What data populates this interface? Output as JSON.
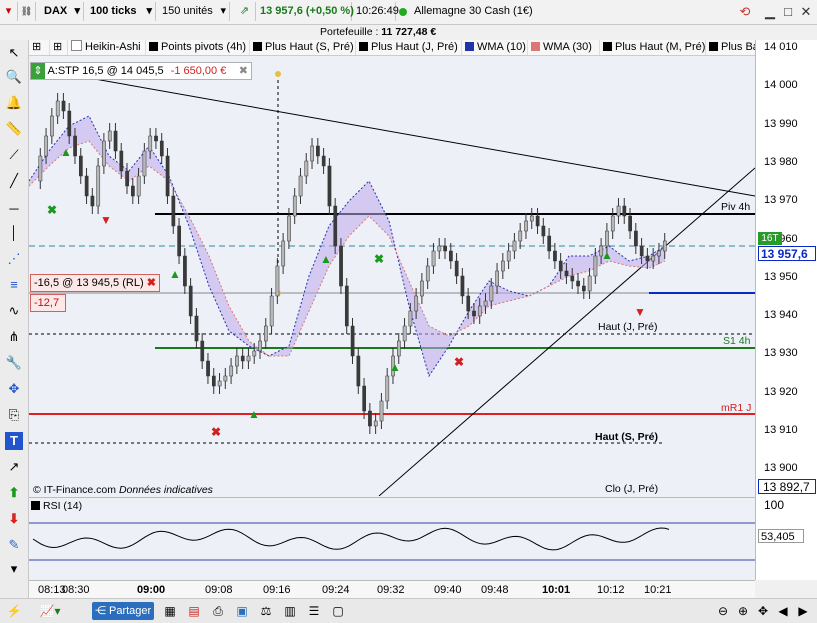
{
  "toolbar": {
    "instrument": "DAX",
    "timeframe": "100 ticks",
    "quantity": "150 unités",
    "price_change": "13 957,6 (+0,50 %)",
    "time": "10:26:49",
    "market_name": "Allemagne 30 Cash (1€)"
  },
  "portfolio": {
    "label": "Portefeuille :",
    "value": "11 727,48 €"
  },
  "indicators": [
    {
      "label": "Heikin-Ashi",
      "color": "#ffffff"
    },
    {
      "label": "Points pivots (4h)",
      "color": "#000000"
    },
    {
      "label": "Plus Haut (S, Pré)",
      "color": "#000000"
    },
    {
      "label": "Plus Haut (J, Pré)",
      "color": "#000000"
    },
    {
      "label": "WMA (10)",
      "color": "#2233aa"
    },
    {
      "label": "WMA (30)",
      "color": "#dd7777"
    },
    {
      "label": "Plus Haut (M, Pré)",
      "color": "#000000"
    },
    {
      "label": "Plus Bas",
      "color": "#000000"
    }
  ],
  "orders": {
    "stop_label": "A:STP",
    "stop_value": "16,5 @ 14 045,5",
    "stop_pnl": "-1 650,00 €",
    "position_label": "-16,5 @ 13 945,5 (RL)",
    "position_pnl": "-12,7"
  },
  "levels": {
    "piv": "Piv 4h",
    "s1": "S1 4h",
    "mr1": "mR1 J",
    "haut_j": "Haut (J, Pré)",
    "haut_s": "Haut (S, Pré)",
    "clo": "Clo (J, Pré)"
  },
  "price_axis": {
    "ticks": [
      "14 010",
      "14 000",
      "13 990",
      "13 980",
      "13 970",
      "13 960",
      "13 950",
      "13 940",
      "13 930",
      "13 920",
      "13 910",
      "13 900"
    ],
    "last_price": "13 957,6",
    "tick_badge": "16T",
    "blue_level": "13 892,7",
    "rsi_top": "100",
    "rsi_value": "53,405"
  },
  "copyright": "© IT-Finance.com",
  "data_note": "Données indicatives",
  "rsi_label": "RSI (14)",
  "time_axis": [
    "08:13",
    "08:30",
    "09:00",
    "09:08",
    "09:16",
    "09:24",
    "09:32",
    "09:40",
    "09:48",
    "10:01",
    "10:12",
    "10:21"
  ],
  "bottom": {
    "share_label": "Partager"
  },
  "colors": {
    "up": "#b7b7b7",
    "down": "#3a3a3a",
    "green": "#1a7a1a",
    "red": "#e02020",
    "blue": "#0a28c8"
  }
}
